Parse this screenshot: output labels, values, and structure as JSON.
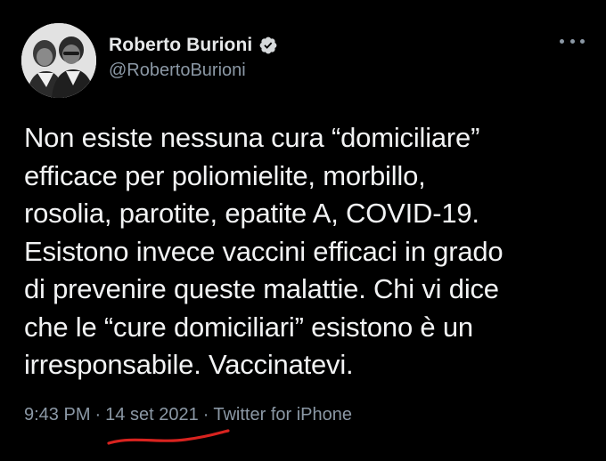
{
  "user": {
    "display_name": "Roberto Burioni",
    "handle": "@RobertoBurioni",
    "verified": true
  },
  "icons": {
    "verified": "verified-badge-icon",
    "more": "more-options-icon"
  },
  "tweet": {
    "lines": [
      "Non esiste nessuna cura “domiciliare”",
      "efficace per poliomielite, morbillo,",
      "rosolia, parotite, epatite A, COVID-19.",
      "Esistono invece vaccini efficaci in grado",
      "di prevenire queste malattie. Chi vi dice",
      "che le “cure domiciliari” esistono è un",
      "irresponsabile. Vaccinatevi."
    ]
  },
  "meta": {
    "time": "9:43 PM",
    "separator": "·",
    "date": "14 set 2021",
    "source": "Twitter for iPhone"
  },
  "colors": {
    "background": "#000000",
    "text": "#e7e9ea",
    "secondary": "#8b98a5",
    "verified_badge": "#d6d9db",
    "underline_annotation": "#d8231f"
  }
}
